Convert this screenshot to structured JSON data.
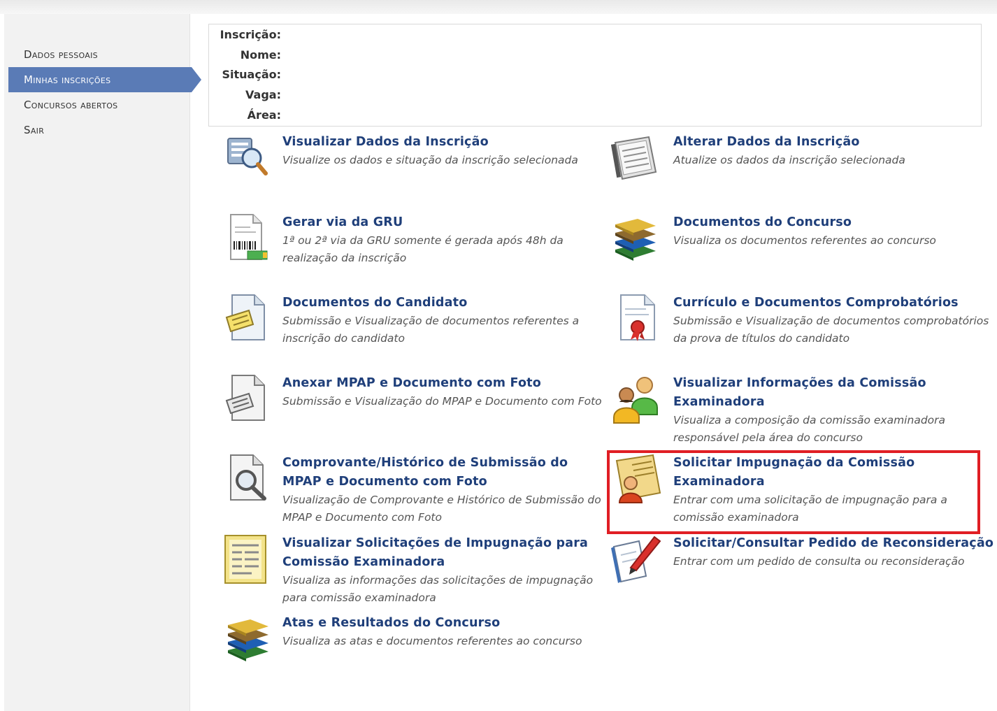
{
  "sidebar": {
    "items": [
      {
        "label": "Dados pessoais",
        "active": false
      },
      {
        "label": "Minhas inscrições",
        "active": true
      },
      {
        "label": "Concursos abertos",
        "active": false
      },
      {
        "label": "Sair",
        "active": false
      }
    ]
  },
  "info": {
    "inscricao_label": "Inscrição:",
    "nome_label": "Nome:",
    "situacao_label": "Situação:",
    "vaga_label": "Vaga:",
    "area_label": "Área:"
  },
  "actions": [
    {
      "title": "Visualizar Dados da Inscrição",
      "desc": "Visualize os dados e situação da inscrição selecionada",
      "icon": "magnifier-gear-icon"
    },
    {
      "title": "Alterar Dados da Inscrição",
      "desc": "Atualize os dados da inscrição selecionada",
      "icon": "address-book-icon"
    },
    {
      "title": "Gerar via da GRU",
      "desc": "1ª ou 2ª via da GRU somente é gerada após 48h da realização da inscrição",
      "icon": "barcode-document-icon"
    },
    {
      "title": "Documentos do Concurso",
      "desc": "Visualiza os documentos referentes ao concurso",
      "icon": "books-icon"
    },
    {
      "title": "Documentos do Candidato",
      "desc": "Submissão e Visualização de documentos referentes a inscrição do candidato",
      "icon": "document-note-icon"
    },
    {
      "title": "Currículo e Documentos Comprobatórios",
      "desc": "Submissão e Visualização de documentos comprobatórios da prova de títulos do candidato",
      "icon": "certificate-document-icon"
    },
    {
      "title": "Anexar MPAP e Documento com Foto",
      "desc": "Submissão e Visualização do MPAP e Documento com Foto",
      "icon": "document-attach-icon"
    },
    {
      "title": "Visualizar Informações da Comissão Examinadora",
      "desc": "Visualiza a composição da comissão examinadora responsável pela área do concurso",
      "icon": "users-group-icon"
    },
    {
      "title": "Comprovante/Histórico de Submissão do MPAP e Documento com Foto",
      "desc": "Visualização de Comprovante e Histórico de Submissão do MPAP e Documento com Foto",
      "icon": "document-search-icon"
    },
    {
      "title": "Solicitar Impugnação da Comissão Examinadora",
      "desc": "Entrar com uma solicitação de impugnação para a comissão examinadora",
      "icon": "user-card-icon"
    },
    {
      "title": "Visualizar Solicitações de Impugnação para Comissão Examinadora",
      "desc": "Visualiza as informações das solicitações de impugnação para comissão examinadora",
      "icon": "list-document-icon"
    },
    {
      "title": "Solicitar/Consultar Pedido de Reconsideração",
      "desc": "Entrar com um pedido de consulta ou reconsideração",
      "icon": "pen-paper-icon"
    },
    {
      "title": "Atas e Resultados do Concurso",
      "desc": "Visualiza as atas e documentos referentes ao concurso",
      "icon": "books-icon"
    }
  ],
  "colors": {
    "accent": "#5a7bb6",
    "link": "#1f3f7a",
    "highlight": "#e01e24"
  }
}
